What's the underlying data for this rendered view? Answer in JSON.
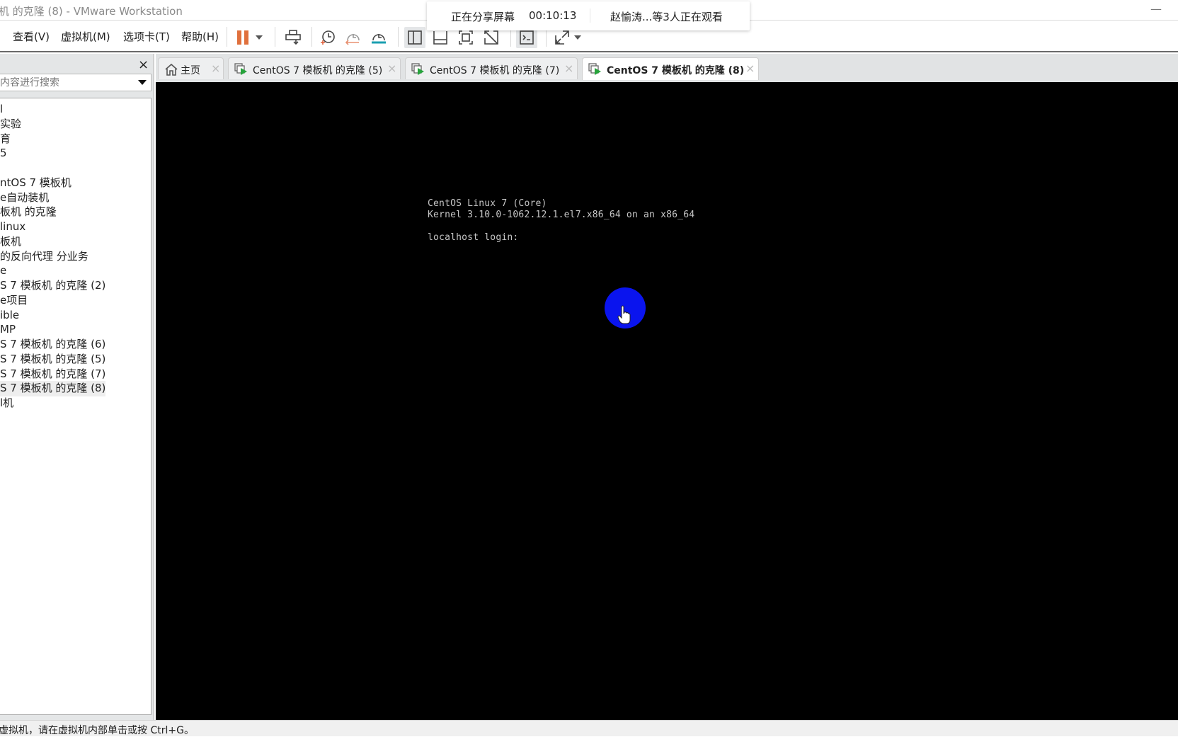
{
  "window": {
    "title": "机 的克隆 (8) - VMware Workstation",
    "minimize_glyph": "—"
  },
  "menubar": {
    "items": [
      "查看(V)",
      "虚拟机(M)",
      "选项卡(T)",
      "帮助(H)"
    ]
  },
  "toolbar": {
    "icons": [
      "pause-icon",
      "dropdown-arrow-icon",
      "send-ctrl-alt-del-icon",
      "take-snapshot-icon",
      "revert-snapshot-icon",
      "snapshot-manager-icon",
      "show-library-icon",
      "thumbnail-bar-icon",
      "fullscreen-icon",
      "unity-icon",
      "console-view-icon",
      "stretch-icon",
      "stretch-dropdown-icon"
    ],
    "accent_pause": "#e0703c"
  },
  "share_banner": {
    "status": "正在分享屏幕",
    "timer": "00:10:13",
    "viewers": "赵愉涛...等3人正在观看"
  },
  "library": {
    "close_glyph": "×",
    "search_placeholder": "内容进行搜索",
    "items": [
      "l",
      "实验",
      "育",
      "5",
      "",
      "ntOS 7 模板机",
      "e自动装机",
      "板机 的克隆",
      " linux",
      "板机",
      "的反向代理 分业务",
      "e",
      "S 7 模板机 的克隆 (2)",
      "e项目",
      "ible",
      "MP",
      "S 7 模板机 的克隆 (6)",
      "S 7 模板机 的克隆 (5)",
      "S 7 模板机 的克隆 (7)",
      "S 7 模板机 的克隆 (8)",
      "l机"
    ],
    "selected_index": 19
  },
  "tabs": [
    {
      "label": "主页",
      "icon": "home-icon",
      "active": false
    },
    {
      "label": "CentOS 7 模板机 的克隆 (5)",
      "icon": "vm-running-icon",
      "active": false
    },
    {
      "label": "CentOS 7 模板机 的克隆 (7)",
      "icon": "vm-running-icon",
      "active": false
    },
    {
      "label": "CentOS 7 模板机 的克隆 (8)",
      "icon": "vm-running-icon",
      "active": true
    }
  ],
  "tab_close_glyph": "×",
  "console": {
    "line1": "CentOS Linux 7 (Core)",
    "line2": "Kernel 3.10.0-1062.12.1.el7.x86_64 on an x86_64",
    "line3": "localhost login:"
  },
  "statusbar": {
    "text": "虚拟机，请在虚拟机内部单击或按 Ctrl+G。"
  }
}
